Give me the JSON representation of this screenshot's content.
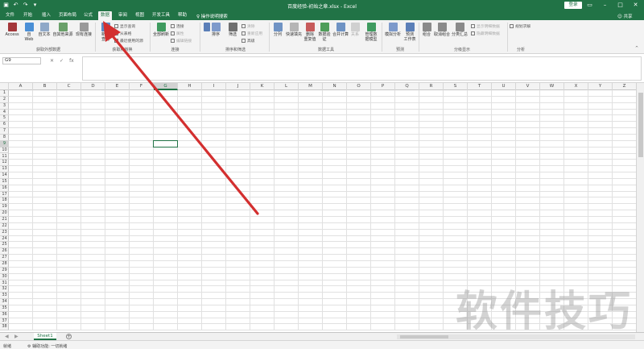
{
  "titlebar": {
    "doc_title": "百度经验-初始之章.xlsx  -  Excel",
    "login": "登录",
    "qat_icons": [
      "save-icon",
      "undo-icon",
      "redo-icon",
      "customize-icon"
    ]
  },
  "tabs": [
    "文件",
    "开始",
    "插入",
    "页面布局",
    "公式",
    "数据",
    "审阅",
    "视图",
    "开发工具",
    "帮助"
  ],
  "active_tab": "数据",
  "tellme": "操作说明搜索",
  "share": "共享",
  "ribbon": {
    "get_external": {
      "buttons": [
        "Access",
        "自\nWeb",
        "自文本",
        "自其他来源",
        "现有连接"
      ],
      "label": "获取外部数据"
    },
    "get_transform": {
      "buttons": [
        "新建\n查询"
      ],
      "small": [
        "显示查询",
        "从表格",
        "最近使用的源"
      ],
      "label": "获取和转换"
    },
    "connections": {
      "buttons": [
        "全部刷新"
      ],
      "small": [
        "连接",
        "属性",
        "编辑链接"
      ],
      "label": "连接"
    },
    "sort_filter": {
      "buttons": [
        "排序",
        "筛选"
      ],
      "small": [
        "清除",
        "重新应用",
        "高级"
      ],
      "label": "排序和筛选"
    },
    "data_tools": {
      "buttons": [
        "分列",
        "快速填充",
        "删除\n重复值",
        "数据验\n证",
        "合并计算",
        "关系",
        "管理数\n据模型"
      ],
      "label": "数据工具"
    },
    "forecast": {
      "buttons": [
        "模拟分析",
        "预测\n工作表"
      ],
      "label": "预测"
    },
    "outline": {
      "buttons": [
        "组合",
        "取消组合",
        "分类汇总"
      ],
      "small": [
        "显示明细数据",
        "隐藏明细数据"
      ],
      "label": "分级显示"
    },
    "analysis": {
      "small": [
        "规划求解"
      ],
      "label": "分析"
    }
  },
  "formula_bar": {
    "name_box": "G9",
    "fx": "fx",
    "value": ""
  },
  "grid": {
    "columns": [
      "A",
      "B",
      "C",
      "D",
      "E",
      "F",
      "G",
      "H",
      "I",
      "J",
      "K",
      "L",
      "M",
      "N",
      "O",
      "P",
      "Q",
      "R",
      "S",
      "T",
      "U",
      "V",
      "W",
      "X",
      "Y",
      "Z"
    ],
    "row_count": 38,
    "active_cell": "G9",
    "active_col": "G",
    "active_row": 9
  },
  "sheets": [
    "Sheet1"
  ],
  "active_sheet": "Sheet1",
  "status": {
    "ready": "就绪",
    "accessibility": "辅助功能: 一切就绪"
  },
  "watermark": "软件技巧",
  "colors": {
    "brand": "#217346",
    "annotation": "#d32f2f"
  }
}
